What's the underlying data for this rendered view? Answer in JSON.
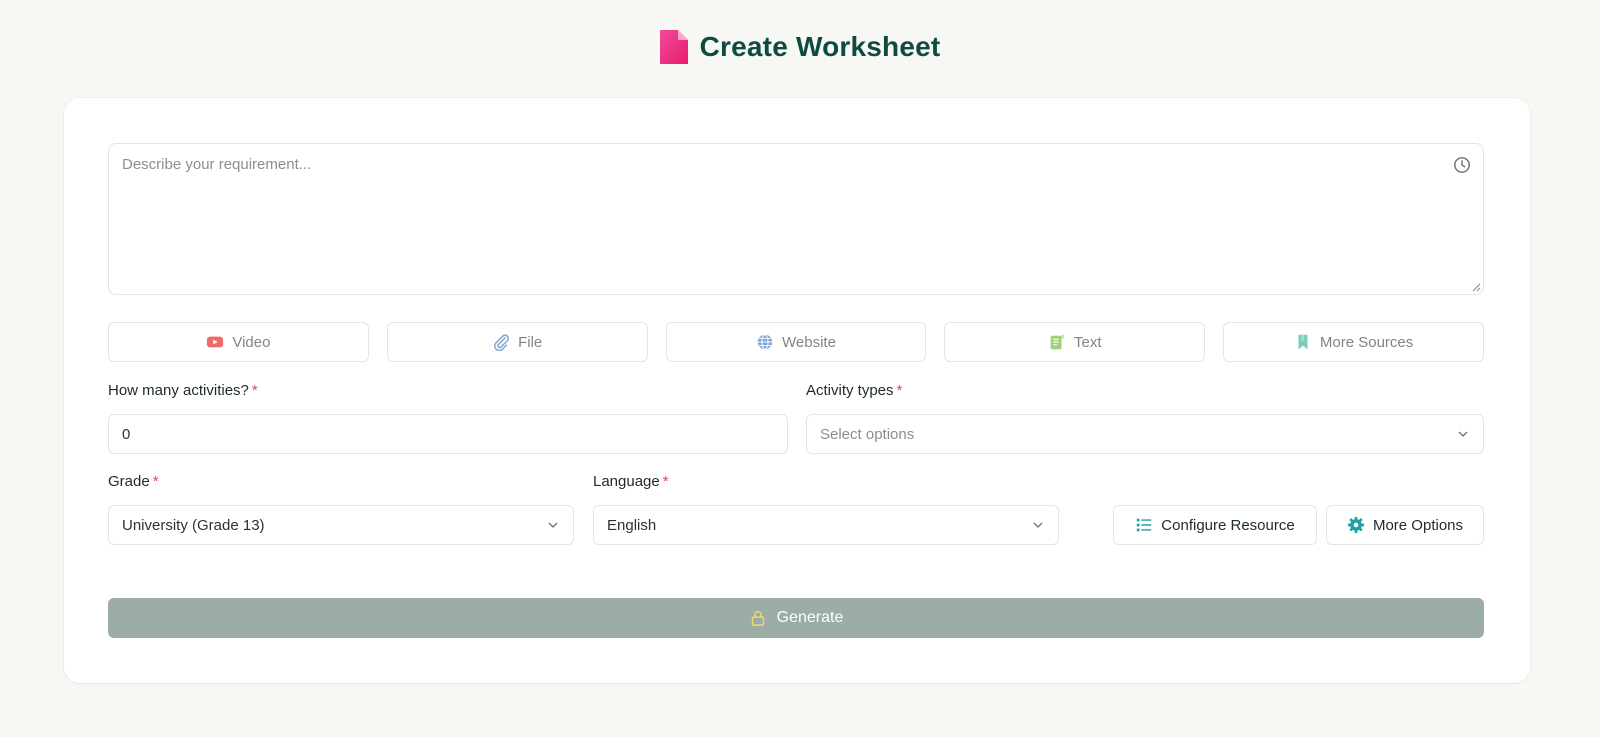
{
  "header": {
    "title": "Create Worksheet",
    "icon": "document-icon"
  },
  "prompt": {
    "placeholder": "Describe your requirement...",
    "value": "",
    "icon": "history-icon"
  },
  "sources": [
    {
      "label": "Video",
      "icon": "youtube-icon",
      "color": "#f06a6a"
    },
    {
      "label": "File",
      "icon": "paperclip-icon",
      "color": "#7fa8d8"
    },
    {
      "label": "Website",
      "icon": "globe-icon",
      "color": "#7aa6d6"
    },
    {
      "label": "Text",
      "icon": "text-note-icon",
      "color": "#9fd07a"
    },
    {
      "label": "More Sources",
      "icon": "bookmark-icon",
      "color": "#7ccdb8"
    }
  ],
  "activities": {
    "label": "How many activities?",
    "required": "*",
    "value": "0"
  },
  "activity_types": {
    "label": "Activity types",
    "required": "*",
    "placeholder": "Select options"
  },
  "grade": {
    "label": "Grade",
    "required": "*",
    "value": "University (Grade 13)"
  },
  "language": {
    "label": "Language",
    "required": "*",
    "value": "English"
  },
  "options": {
    "configure_label": "Configure Resource",
    "more_label": "More Options"
  },
  "generate": {
    "label": "Generate",
    "icon": "lock-icon"
  },
  "colors": {
    "accent": "#0f4a3f",
    "brand_pink": "#e8277a",
    "teal": "#1aa3a0",
    "generate_bg": "#9caca7",
    "required": "#e04a4a"
  }
}
